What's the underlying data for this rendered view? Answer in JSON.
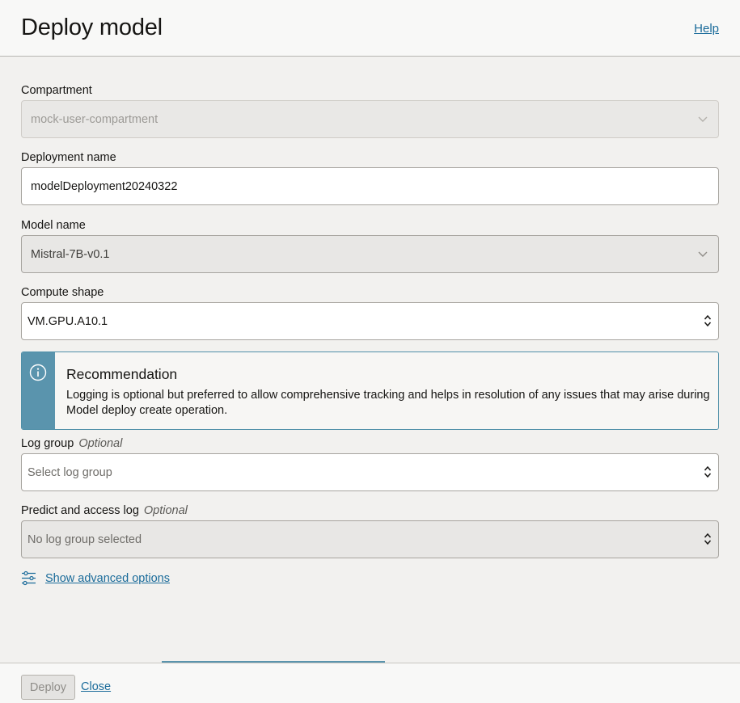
{
  "header": {
    "title": "Deploy model",
    "help_label": "Help"
  },
  "form": {
    "compartment": {
      "label": "Compartment",
      "value": "mock-user-compartment",
      "icon": "chevron-down-icon"
    },
    "deployment_name": {
      "label": "Deployment name",
      "value": "modelDeployment20240322"
    },
    "model_name": {
      "label": "Model name",
      "value": "Mistral-7B-v0.1",
      "icon": "chevron-down-icon"
    },
    "compute_shape": {
      "label": "Compute shape",
      "value": "VM.GPU.A10.1",
      "icon": "select-arrows-icon"
    },
    "recommendation": {
      "title": "Recommendation",
      "text": "Logging is optional but preferred to allow comprehensive tracking and helps in resolution of any issues that may arise during Model deploy create operation.",
      "icon": "info-icon",
      "accent": "#5a94ad"
    },
    "log_group": {
      "label": "Log group",
      "optional": "Optional",
      "placeholder": "Select log group",
      "icon": "select-arrows-icon"
    },
    "predict_access_log": {
      "label": "Predict and access log",
      "optional": "Optional",
      "placeholder": "No log group selected",
      "icon": "select-arrows-icon"
    },
    "advanced": {
      "label": "Show advanced options",
      "icon": "sliders-icon"
    }
  },
  "footer": {
    "deploy_label": "Deploy",
    "close_label": "Close"
  },
  "colors": {
    "link": "#1a6b9a",
    "background": "#f2f1ef"
  }
}
